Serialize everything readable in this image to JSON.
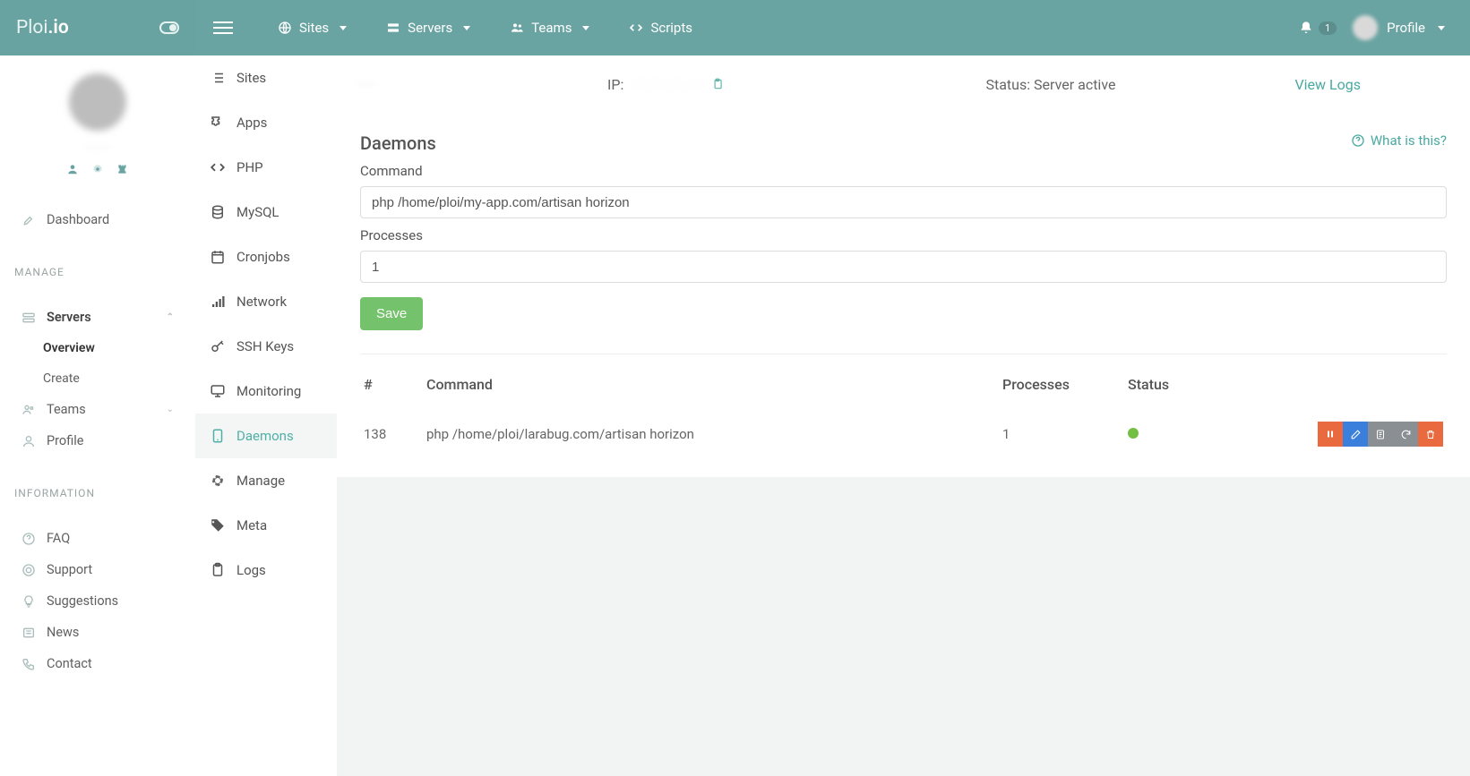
{
  "brand": {
    "name": "Ploi",
    "suffix": ".io"
  },
  "topnav": {
    "sites": "Sites",
    "servers": "Servers",
    "teams": "Teams",
    "scripts": "Scripts"
  },
  "topright": {
    "notifications_count": "1",
    "profile": "Profile"
  },
  "left_user": {
    "name": "······"
  },
  "left_menu": {
    "dashboard": "Dashboard",
    "manage_title": "MANAGE",
    "servers": "Servers",
    "servers_overview": "Overview",
    "servers_create": "Create",
    "teams": "Teams",
    "profile": "Profile",
    "info_title": "INFORMATION",
    "faq": "FAQ",
    "support": "Support",
    "suggestions": "Suggestions",
    "news": "News",
    "contact": "Contact"
  },
  "secondnav": {
    "sites": "Sites",
    "apps": "Apps",
    "php": "PHP",
    "mysql": "MySQL",
    "cronjobs": "Cronjobs",
    "network": "Network",
    "sshkeys": "SSH Keys",
    "monitoring": "Monitoring",
    "daemons": "Daemons",
    "manage": "Manage",
    "meta": "Meta",
    "logs": "Logs"
  },
  "serverbar": {
    "name": "·····",
    "ip_label": "IP:",
    "ip_value": "···.···.···.···",
    "status_label": "Status:",
    "status_value": "Server active",
    "view_logs": "View Logs"
  },
  "panel": {
    "title": "Daemons",
    "what_is_this": "What is this?",
    "command_label": "Command",
    "command_value": "php /home/ploi/my-app.com/artisan horizon",
    "processes_label": "Processes",
    "processes_value": "1",
    "save": "Save",
    "table": {
      "cols": {
        "num": "#",
        "command": "Command",
        "processes": "Processes",
        "status": "Status"
      },
      "rows": [
        {
          "id": "138",
          "command": "php /home/ploi/larabug.com/artisan horizon",
          "processes": "1"
        }
      ]
    }
  }
}
